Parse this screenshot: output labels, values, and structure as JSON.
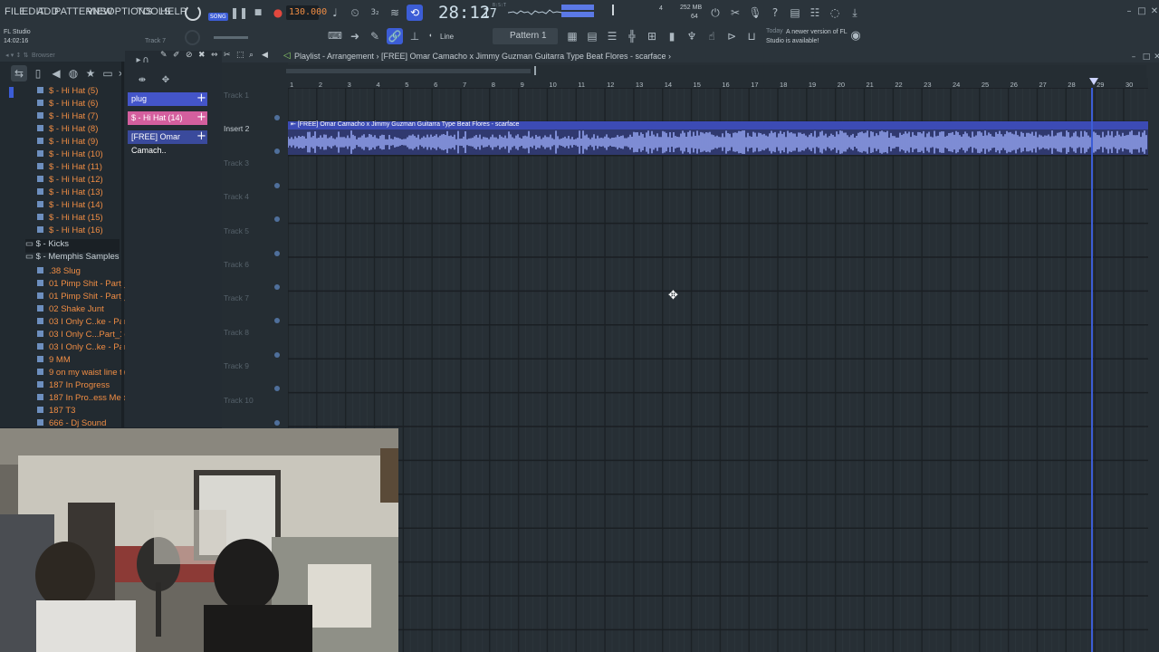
{
  "menu": [
    "FILE",
    "EDIT",
    "ADD",
    "PATTERNS",
    "VIEW",
    "OPTIONS",
    "TOOLS",
    "HELP"
  ],
  "app": {
    "name": "FL Studio",
    "time": "14:02:16",
    "track_hint": "Track 7"
  },
  "song_toggle": "SONG",
  "tempo": "130.000",
  "clock": {
    "main": "28:12",
    "sub": "17",
    "small": "B:S:T"
  },
  "perf": {
    "mem": "252 MB",
    "voices": "64",
    "cpu": "4"
  },
  "snap_label": "Line",
  "pattern_label": "Pattern 1",
  "update_notice": {
    "day": "Today",
    "message": "A newer version of FL Studio is available!"
  },
  "browser": {
    "title": "Browser",
    "items": [
      "$ - Hi Hat (5)",
      "$ - Hi Hat (6)",
      "$ - Hi Hat (7)",
      "$ - Hi Hat (8)",
      "$ - Hi Hat (9)",
      "$ - Hi Hat (10)",
      "$ - Hi Hat (11)",
      "$ - Hi Hat (12)",
      "$ - Hi Hat (13)",
      "$ - Hi Hat (14)",
      "$ - Hi Hat (15)",
      "$ - Hi Hat (16)"
    ],
    "folders": [
      "$ - Kicks",
      "$ - Memphis Samples"
    ],
    "samples": [
      ".38 Slug",
      "01 Pimp Shit - Part_1",
      "01 Pimp Shit - Part_2",
      "02 Shake Junt",
      "03 I Only C..ke - Part_1",
      "03 I Only C...Part_1ddf",
      "03 I Only C..ke - Part_2",
      "9 MM",
      "9 on my waist line twiii",
      "187 In Progress",
      "187 In Pro..ess Melody",
      "187 T3",
      "666 - Dj Sound"
    ]
  },
  "picker": [
    "plug",
    "$ - Hi Hat (14)",
    "[FREE] Omar Camach.."
  ],
  "playlist": {
    "breadcrumb": "Playlist - Arrangement › [FREE] Omar Camacho x Jimmy Guzman Guitarra Type Beat Flores - scarface ›",
    "clip_title": "[FREE] Omar Camacho x Jimmy Guzman Guitarra Type Beat Flores - scarface",
    "tracks": [
      "Track 1",
      "Insert 2",
      "Track 3",
      "Track 4",
      "Track 5",
      "Track 6",
      "Track 7",
      "Track 8",
      "Track 9",
      "Track 10"
    ],
    "bars": [
      "1",
      "2",
      "3",
      "4",
      "5",
      "6",
      "7",
      "8",
      "9",
      "10",
      "11",
      "12",
      "13",
      "14",
      "15",
      "16",
      "17",
      "18",
      "19",
      "20",
      "21",
      "22",
      "23",
      "24",
      "25",
      "26",
      "27",
      "28",
      "29",
      "30"
    ]
  },
  "colors": {
    "accent": "#3c5dd6",
    "clip": "#3a4a9c",
    "waveform": "#9fb0ff",
    "browser_item": "#f08d44",
    "picker_pink": "#d45f9e",
    "picker_blue": "#4455c9"
  }
}
